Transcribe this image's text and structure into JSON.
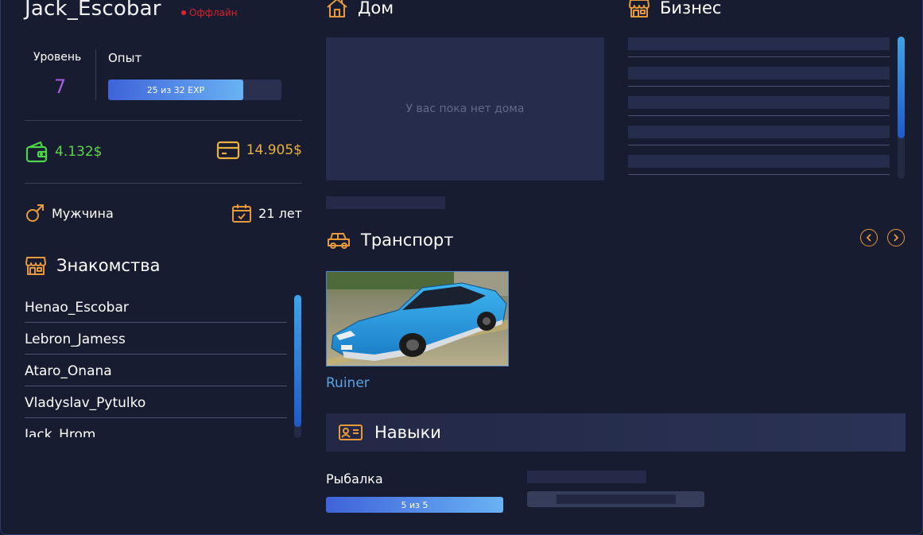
{
  "profile": {
    "name": "Jack_Escobar",
    "status": "Оффлайн",
    "level_label": "Уровень",
    "level_value": "7",
    "exp_label": "Опыт",
    "exp_text": "25 из 32 EXP",
    "exp_progress": 0.78,
    "cash": "4.132$",
    "bank": "14.905$",
    "gender": "Мужчина",
    "age": "21 лет"
  },
  "friends": {
    "title": "Знакомства",
    "items": [
      "Henao_Escobar",
      "Lebron_Jamess",
      "Ataro_Onana",
      "Vladyslav_Pytulko",
      "Jack_Hrom"
    ]
  },
  "home": {
    "title": "Дом",
    "empty_text": "У вас пока нет дома"
  },
  "business": {
    "title": "Бизнес"
  },
  "transport": {
    "title": "Транспорт",
    "vehicles": [
      {
        "name": "Ruiner"
      }
    ]
  },
  "skills": {
    "title": "Навыки",
    "items": [
      {
        "name": "Рыбалка",
        "text": "5 из 5",
        "progress": 1.0
      }
    ]
  },
  "colors": {
    "accent": "#e89a3a",
    "cash": "#5cd64a",
    "bank": "#e8b23c",
    "status": "#d8232a",
    "level": "#a65ce0",
    "link": "#5aa2e6"
  },
  "icons": [
    "home-icon",
    "store-icon",
    "wallet-icon",
    "card-icon",
    "male-icon",
    "calendar-icon",
    "car-icon",
    "id-card-icon",
    "chevron-left-icon",
    "chevron-right-icon"
  ]
}
